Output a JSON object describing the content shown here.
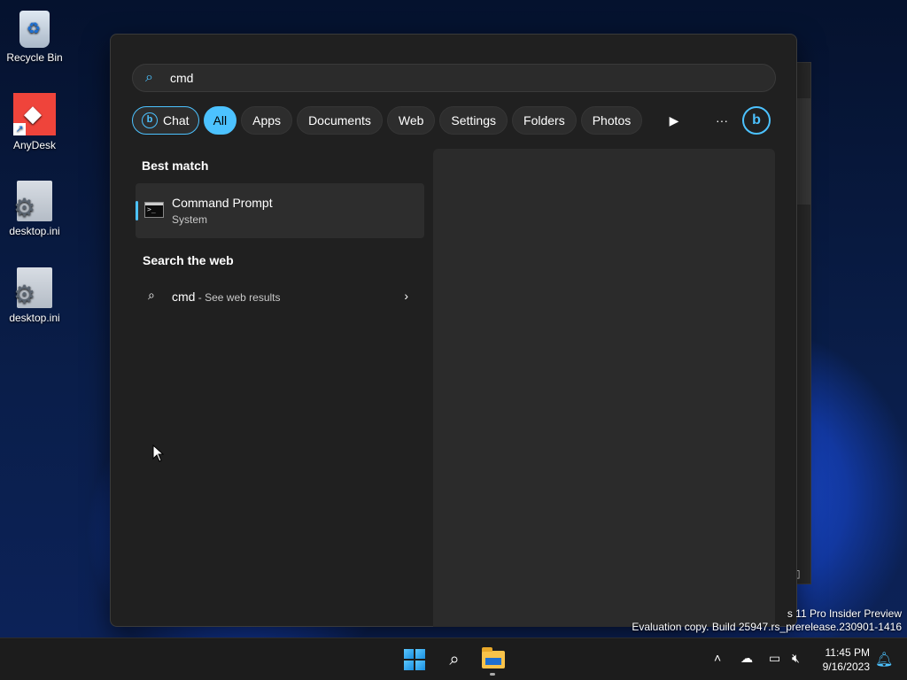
{
  "desktop": {
    "icons": [
      {
        "label": "Recycle Bin",
        "icon": "recycle-bin-icon"
      },
      {
        "label": "AnyDesk",
        "icon": "anydesk-icon"
      },
      {
        "label": "desktop.ini",
        "icon": "settings-file-icon"
      },
      {
        "label": "desktop.ini",
        "icon": "settings-file-icon"
      }
    ],
    "watermark": {
      "line1": "s 11 Pro Insider Preview",
      "line2": "Evaluation copy. Build 25947.rs_prerelease.230901-1416"
    }
  },
  "search": {
    "query": "cmd",
    "filters": [
      {
        "label": "Chat",
        "active": false
      },
      {
        "label": "All",
        "active": true
      },
      {
        "label": "Apps",
        "active": false
      },
      {
        "label": "Documents",
        "active": false
      },
      {
        "label": "Web",
        "active": false
      },
      {
        "label": "Settings",
        "active": false
      },
      {
        "label": "Folders",
        "active": false
      },
      {
        "label": "Photos",
        "active": false
      }
    ],
    "best_match_title": "Best match",
    "best_match": {
      "name": "Command Prompt",
      "subtitle": "System"
    },
    "web_title": "Search the web",
    "web_result": {
      "query": "cmd",
      "suffix": " - See web results"
    }
  },
  "taskbar": {
    "clock_time": "11:45 PM",
    "clock_date": "9/16/2023"
  },
  "colors": {
    "accent": "#4cc2ff",
    "panel_bg": "#202020",
    "taskbar_bg": "#1c1c1c"
  }
}
